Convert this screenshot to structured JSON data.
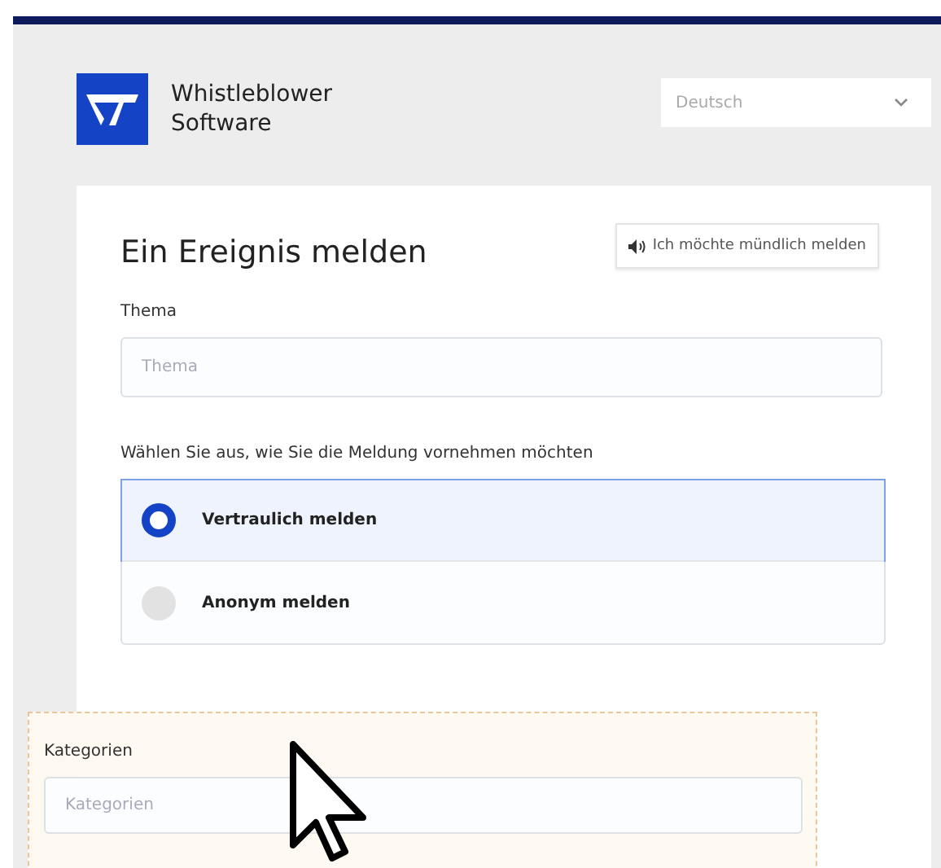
{
  "header": {
    "brand_name": "Whistleblower Software",
    "language_select": {
      "value": "Deutsch"
    }
  },
  "form": {
    "title": "Ein Ereignis melden",
    "voice_button": "Ich möchte mündlich melden",
    "subject": {
      "label": "Thema",
      "placeholder": "Thema"
    },
    "mode_question": "Wählen Sie aus, wie Sie die Meldung vornehmen möchten",
    "options": [
      {
        "label": "Vertraulich melden",
        "selected": true
      },
      {
        "label": "Anonym melden",
        "selected": false
      }
    ]
  },
  "dragged_field": {
    "label": "Kategorien",
    "placeholder": "Kategorien"
  }
}
